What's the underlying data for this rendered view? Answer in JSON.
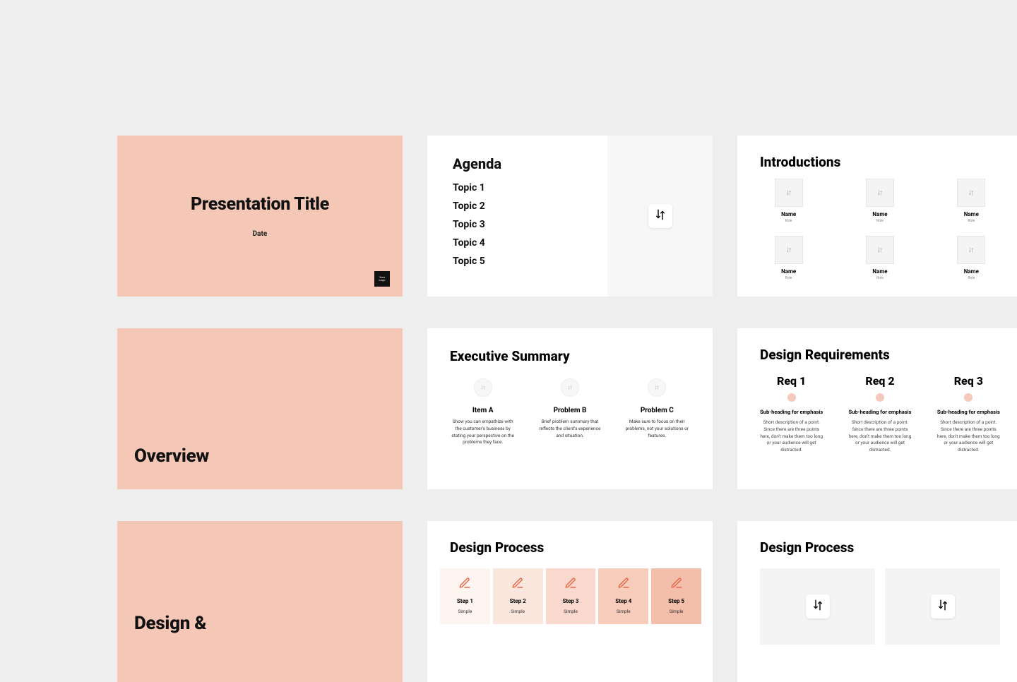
{
  "colors": {
    "peach": "#f4c7b6",
    "edit_icon": "#e96a4a"
  },
  "slides": {
    "title": {
      "title": "Presentation Title",
      "date": "Date",
      "logo_text": "Your Logo"
    },
    "agenda": {
      "title": "Agenda",
      "topics": [
        "Topic 1",
        "Topic 2",
        "Topic 3",
        "Topic 4",
        "Topic 5"
      ]
    },
    "introductions": {
      "title": "Introductions",
      "people": [
        {
          "name": "Name",
          "role": "Role"
        },
        {
          "name": "Name",
          "role": "Role"
        },
        {
          "name": "Name",
          "role": "Role"
        },
        {
          "name": "Name",
          "role": "Role"
        },
        {
          "name": "Name",
          "role": "Role"
        },
        {
          "name": "Name",
          "role": "Role"
        }
      ]
    },
    "overview": {
      "title": "Overview"
    },
    "exec_summary": {
      "title": "Executive Summary",
      "items": [
        {
          "title": "Item A",
          "desc": "Show you can empathize with the customer's business by stating your perspective on the problems they face."
        },
        {
          "title": "Problem B",
          "desc": "Brief problem summary that reflects the client's experience and situation."
        },
        {
          "title": "Problem C",
          "desc": "Make sure to focus on their problems, not your solutions or features."
        }
      ]
    },
    "requirements": {
      "title": "Design Requirements",
      "items": [
        {
          "title": "Req 1",
          "sub": "Sub-heading for emphasis",
          "desc": "Short description of a point. Since there are three points here, don't make them too long or your audience will get distracted."
        },
        {
          "title": "Req 2",
          "sub": "Sub-heading for emphasis",
          "desc": "Short description of a point. Since there are three points here, don't make them too long or your audience will get distracted."
        },
        {
          "title": "Req 3",
          "sub": "Sub-heading for emphasis",
          "desc": "Short description of a point. Since there are three points here, don't make them too long or your audience will get distracted."
        }
      ]
    },
    "design_and": {
      "title": "Design &"
    },
    "design_process_steps": {
      "title": "Design Process",
      "steps": [
        {
          "title": "Step 1",
          "desc": "Simple",
          "shade": "#fdf3ef"
        },
        {
          "title": "Step 2",
          "desc": "Simple",
          "shade": "#fbe6de"
        },
        {
          "title": "Step 3",
          "desc": "Simple",
          "shade": "#f9d9cd"
        },
        {
          "title": "Step 4",
          "desc": "Simple",
          "shade": "#f7ccbb"
        },
        {
          "title": "Step 5",
          "desc": "Simple",
          "shade": "#f4bfaa"
        }
      ]
    },
    "design_process_ph": {
      "title": "Design Process"
    }
  }
}
